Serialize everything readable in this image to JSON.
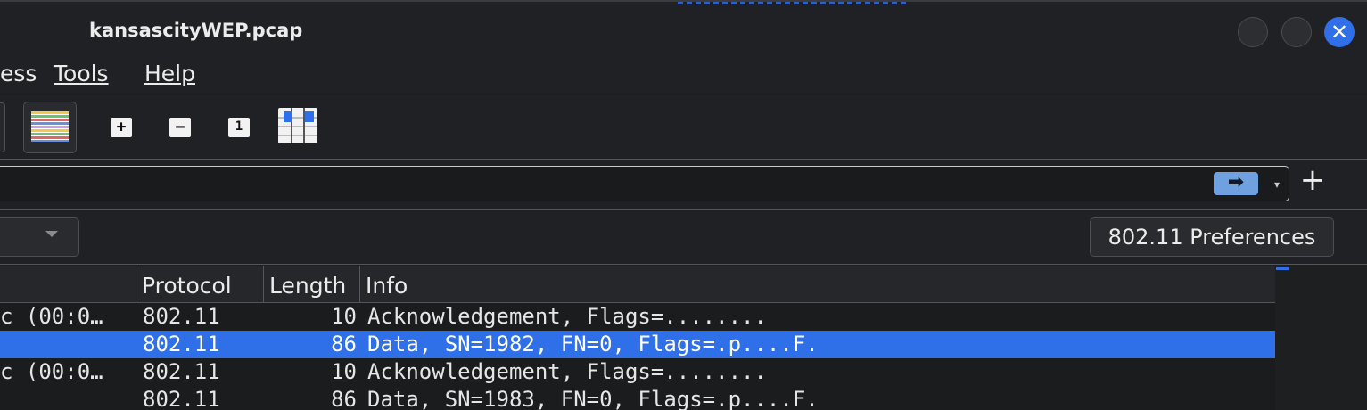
{
  "window": {
    "title": "kansascityWEP.pcap"
  },
  "menu": {
    "process_tail": "ess",
    "tools": "Tools",
    "help": "Help"
  },
  "toolbar": {
    "zoom_in": "+",
    "zoom_out": "−",
    "zoom_normal": "1"
  },
  "filter": {
    "apply_arrow": "➡",
    "dropdown": "▾",
    "add": "+"
  },
  "wlan": {
    "prefs_label": "802.11 Preferences"
  },
  "packets": {
    "columns": [
      "Protocol",
      "Length",
      "Info"
    ],
    "rows": [
      {
        "dest": "c (00:0…",
        "protocol": "802.11",
        "length": "10",
        "info": "Acknowledgement, Flags=........",
        "selected": false
      },
      {
        "dest": "",
        "protocol": "802.11",
        "length": "86",
        "info": "Data, SN=1982, FN=0, Flags=.p....F.",
        "selected": true
      },
      {
        "dest": "c (00:0…",
        "protocol": "802.11",
        "length": "10",
        "info": "Acknowledgement, Flags=........",
        "selected": false
      },
      {
        "dest": "",
        "protocol": "802.11",
        "length": "86",
        "info": "Data, SN=1983, FN=0, Flags=.p....F.",
        "selected": false
      }
    ]
  },
  "colors": {
    "accent": "#2f6fe8",
    "background": "#202124"
  }
}
